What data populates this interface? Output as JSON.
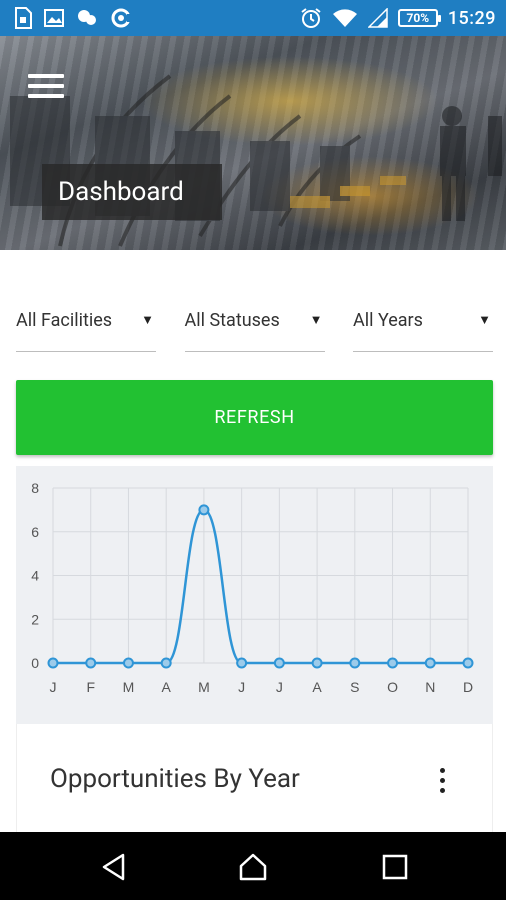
{
  "statusbar": {
    "time": "15:29",
    "battery": "70%",
    "left_icons": [
      "sim-card-icon",
      "image-icon",
      "chat-icon",
      "hotspot-icon"
    ],
    "right_icons": [
      "alarm-icon",
      "wifi-icon",
      "signal-icon",
      "battery-icon"
    ]
  },
  "header": {
    "title": "Dashboard",
    "menu_icon": "hamburger-menu-icon"
  },
  "filters": {
    "facility": "All Facilities",
    "status": "All Statuses",
    "year": "All Years"
  },
  "refresh_label": "REFRESH",
  "chart_data": {
    "type": "line",
    "categories": [
      "J",
      "F",
      "M",
      "A",
      "M",
      "J",
      "J",
      "A",
      "S",
      "O",
      "N",
      "D"
    ],
    "series": [
      {
        "values": [
          0,
          0,
          0,
          0,
          7,
          0,
          0,
          0,
          0,
          0,
          0,
          0
        ],
        "color": "#2f95d6"
      }
    ],
    "y_ticks": [
      "0",
      "2",
      "4",
      "6",
      "8"
    ],
    "ylim": [
      0,
      8
    ],
    "grid": true,
    "title": "",
    "xlabel": "",
    "ylabel": ""
  },
  "opportunities": {
    "title": "Opportunities By Year",
    "menu_icon": "more-vert-icon"
  },
  "navbar": {
    "icons": [
      "back-icon",
      "home-icon",
      "recents-icon"
    ]
  },
  "colors": {
    "statusbar": "#1f7ec2",
    "accent_green": "#22c132",
    "line_blue": "#2f95d6",
    "chart_bg": "#eef0f3"
  }
}
